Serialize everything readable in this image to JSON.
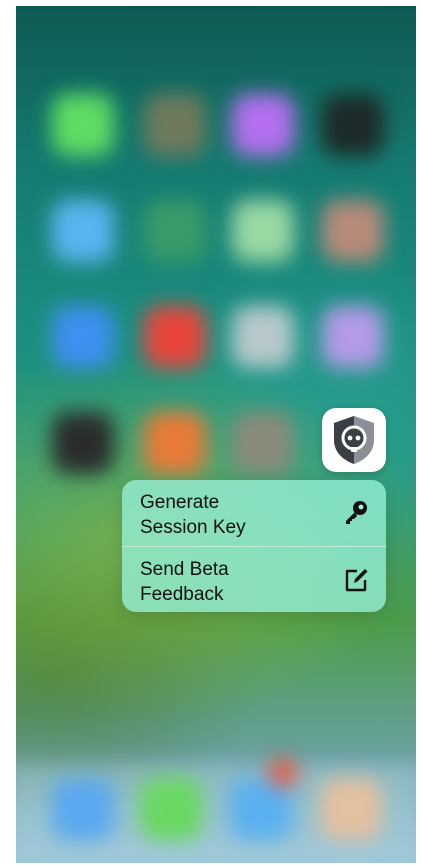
{
  "app": {
    "icon": "shield-face-icon",
    "icon_bg": "#ffffff",
    "shield_dark": "#3a3f45",
    "shield_light": "#8a9096"
  },
  "quick_actions": [
    {
      "label": "Generate\nSession Key",
      "icon": "key-icon"
    },
    {
      "label": "Send Beta\nFeedback",
      "icon": "compose-icon"
    }
  ],
  "colors": {
    "menu_bg": "#96f0d7",
    "text": "#111111"
  }
}
